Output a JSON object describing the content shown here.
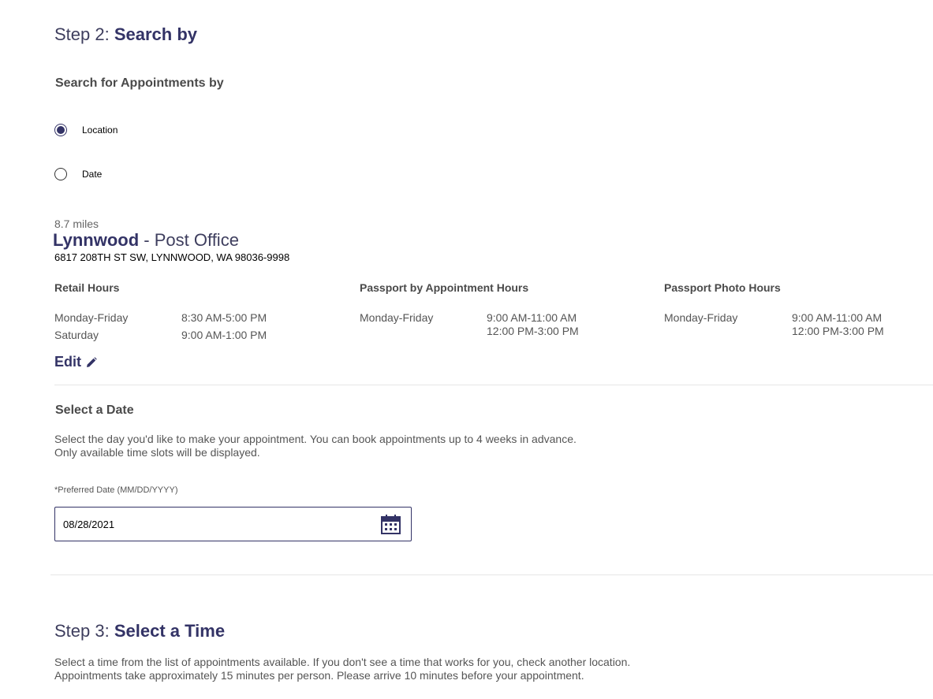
{
  "step2": {
    "prefix": "Step 2:",
    "title": "Search by",
    "subheading": "Search for Appointments by",
    "options": [
      {
        "label": "Location",
        "checked": true
      },
      {
        "label": "Date",
        "checked": false
      }
    ]
  },
  "location": {
    "distance": "8.7 miles",
    "name": "Lynnwood",
    "separator": " - ",
    "type": "Post Office",
    "address": "6817 208TH ST SW, LYNNWOOD, WA 98036-9998",
    "hours": [
      {
        "title": "Retail Hours",
        "rows": [
          {
            "day": "Monday-Friday",
            "times": [
              "8:30 AM-5:00 PM"
            ]
          },
          {
            "day": "Saturday",
            "times": [
              "9:00 AM-1:00 PM"
            ]
          }
        ]
      },
      {
        "title": "Passport by Appointment Hours",
        "rows": [
          {
            "day": "Monday-Friday",
            "times": [
              "9:00 AM-11:00 AM",
              "12:00 PM-3:00 PM"
            ]
          }
        ]
      },
      {
        "title": "Passport Photo Hours",
        "rows": [
          {
            "day": "Monday-Friday",
            "times": [
              "9:00 AM-11:00 AM",
              "12:00 PM-3:00 PM"
            ]
          }
        ]
      }
    ],
    "edit_label": "Edit"
  },
  "select_date": {
    "heading": "Select a Date",
    "line1": "Select the day you'd like to make your appointment. You can book appointments up to 4 weeks in advance.",
    "line2": "Only available time slots will be displayed.",
    "field_label": "*Preferred Date (MM/DD/YYYY)",
    "value": "08/28/2021",
    "icon": "calendar-icon"
  },
  "step3": {
    "prefix": "Step 3:",
    "title": "Select a Time",
    "line1": "Select a time from the list of appointments available. If you don't see a time that works for you, check another location.",
    "line2": "Appointments take approximately 15 minutes per person. Please arrive 10 minutes before your appointment."
  },
  "colors": {
    "brand": "#333366",
    "divider": "#e6e6e6"
  }
}
